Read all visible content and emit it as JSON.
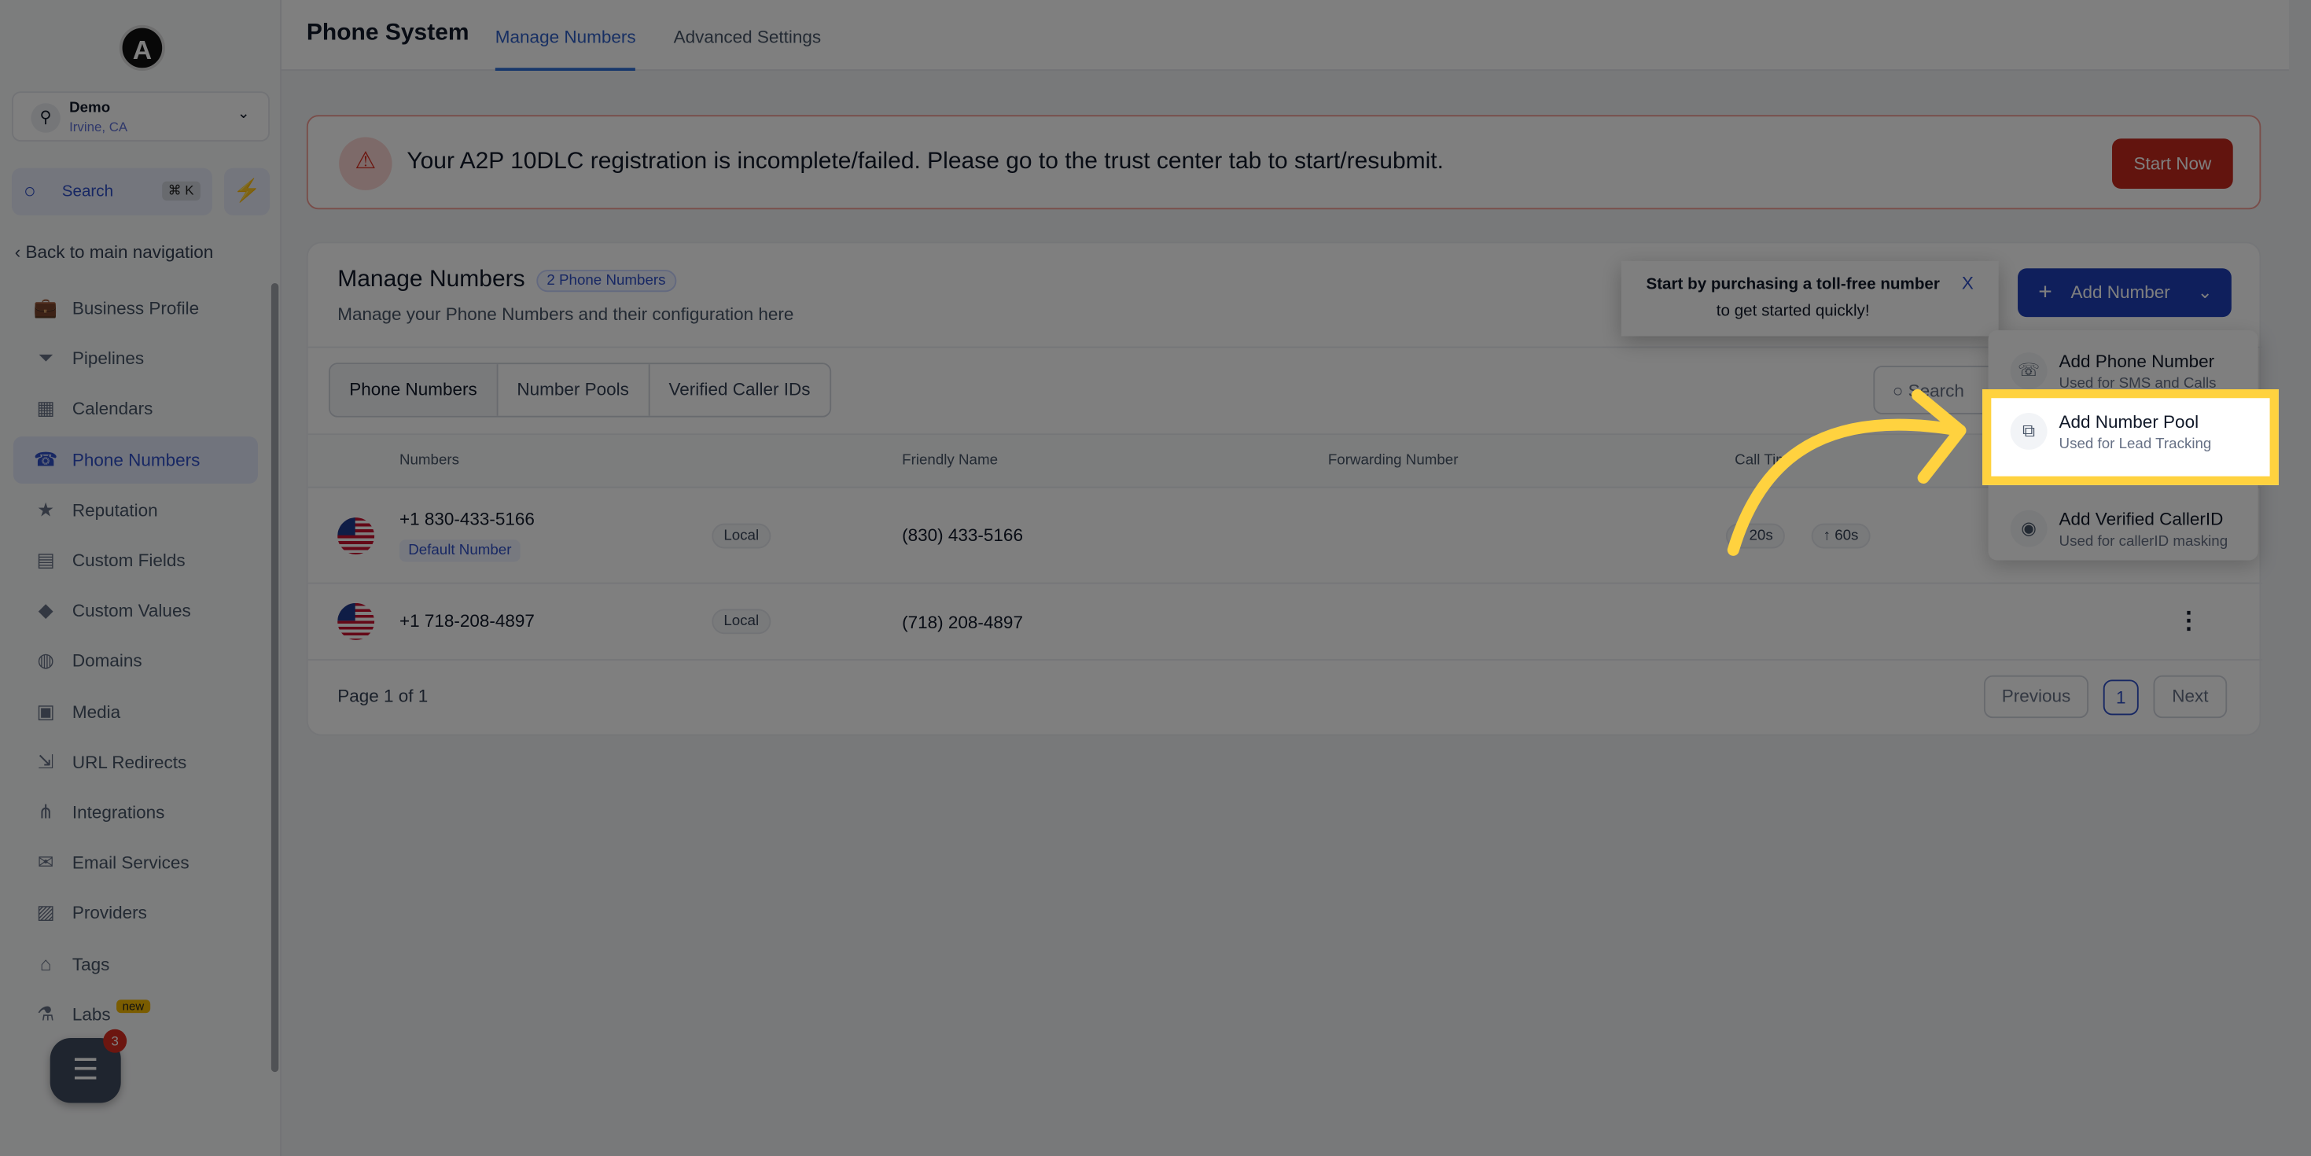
{
  "sidebar": {
    "logo": "A",
    "account": {
      "name": "Demo",
      "location": "Irvine, CA"
    },
    "search": {
      "label": "Search",
      "shortcut": "⌘ K"
    },
    "back": "Back to main navigation",
    "items": [
      {
        "label": "Business Profile",
        "icon": "briefcase-icon",
        "g": "💼"
      },
      {
        "label": "Pipelines",
        "icon": "funnel-icon",
        "g": "⏷"
      },
      {
        "label": "Calendars",
        "icon": "calendar-icon",
        "g": "▦"
      },
      {
        "label": "Phone Numbers",
        "icon": "phone-icon",
        "g": "☎",
        "active": true
      },
      {
        "label": "Reputation",
        "icon": "star-icon",
        "g": "★"
      },
      {
        "label": "Custom Fields",
        "icon": "fields-icon",
        "g": "▤"
      },
      {
        "label": "Custom Values",
        "icon": "values-icon",
        "g": "◆"
      },
      {
        "label": "Domains",
        "icon": "globe-icon",
        "g": "◍"
      },
      {
        "label": "Media",
        "icon": "media-icon",
        "g": "▣"
      },
      {
        "label": "URL Redirects",
        "icon": "redirect-icon",
        "g": "⇲"
      },
      {
        "label": "Integrations",
        "icon": "integrations-icon",
        "g": "⋔"
      },
      {
        "label": "Email Services",
        "icon": "mail-icon",
        "g": "✉"
      },
      {
        "label": "Providers",
        "icon": "providers-icon",
        "g": "▨"
      },
      {
        "label": "Tags",
        "icon": "tag-icon",
        "g": "⌂"
      },
      {
        "label": "Labs",
        "icon": "flask-icon",
        "g": "⚗",
        "badge": "new"
      }
    ],
    "chat_badge": "3"
  },
  "header": {
    "title": "Phone System",
    "tabs": [
      "Manage Numbers",
      "Advanced Settings"
    ]
  },
  "alert": {
    "text": "Your A2P 10DLC registration is incomplete/failed. Please go to the trust center tab to start/resubmit.",
    "button": "Start Now"
  },
  "card": {
    "title": "Manage Numbers",
    "count_badge": "2 Phone Numbers",
    "subtitle": "Manage your Phone Numbers and their configuration here",
    "tabs": [
      "Phone Numbers",
      "Number Pools",
      "Verified Caller IDs"
    ],
    "search_placeholder": "Search",
    "columns": [
      "Numbers",
      "Friendly Name",
      "Forwarding Number",
      "Call Tim"
    ],
    "rows": [
      {
        "number": "+1 830-433-5166",
        "badge": "Default Number",
        "type": "Local",
        "friendly": "(830) 433-5166",
        "timeout_in": "↓ 20s",
        "timeout_out": "↑ 60s"
      },
      {
        "number": "+1 718-208-4897",
        "type": "Local",
        "friendly": "(718) 208-4897"
      }
    ],
    "pagination": {
      "label": "Page 1 of 1",
      "previous": "Previous",
      "page": "1",
      "next": "Next"
    }
  },
  "tooltip": {
    "line1": "Start by purchasing a toll-free number",
    "line2": "to get started quickly!",
    "close": "X"
  },
  "add_number": {
    "label": "Add Number",
    "menu": [
      {
        "title": "Add Phone Number",
        "sub": "Used for SMS and Calls"
      },
      {
        "title": "Add Number Pool",
        "sub": "Used for Lead Tracking",
        "highlighted": true
      },
      {
        "title": "Add Verified CallerID",
        "sub": "Used for callerID masking"
      }
    ]
  },
  "colors": {
    "accent": "#1f3fb8",
    "highlight": "#ffd23f",
    "alert": "#c4291c"
  }
}
